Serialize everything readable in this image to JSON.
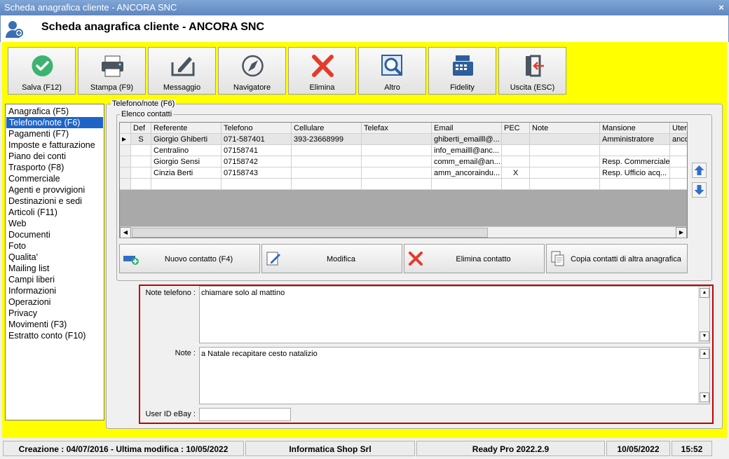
{
  "window": {
    "title": "Scheda anagrafica cliente - ANCORA SNC",
    "close": "×"
  },
  "header": {
    "title": "Scheda anagrafica cliente - ANCORA SNC"
  },
  "toolbar": [
    {
      "label": "Salva (F12)",
      "icon": "check-icon"
    },
    {
      "label": "Stampa (F9)",
      "icon": "printer-icon"
    },
    {
      "label": "Messaggio",
      "icon": "message-icon"
    },
    {
      "label": "Navigatore",
      "icon": "compass-icon"
    },
    {
      "label": "Elimina",
      "icon": "delete-icon"
    },
    {
      "label": "Altro",
      "icon": "magnifier-icon"
    },
    {
      "label": "Fidelity",
      "icon": "cash-register-icon"
    },
    {
      "label": "Uscita (ESC)",
      "icon": "exit-icon"
    }
  ],
  "sidebar": {
    "selected": 1,
    "items": [
      "Anagrafica (F5)",
      "Telefono/note (F6)",
      "Pagamenti (F7)",
      "Imposte e fatturazione",
      "Piano dei conti",
      "Trasporto (F8)",
      "Commerciale",
      "Agenti e provvigioni",
      "Destinazioni e sedi",
      "Articoli (F11)",
      "Web",
      "Documenti",
      "Foto",
      "Qualita'",
      "Mailing list",
      "Campi liberi",
      "Informazioni",
      "Operazioni",
      "Privacy",
      "Movimenti (F3)",
      "Estratto conto (F10)"
    ]
  },
  "panel": {
    "legend": "Telefono/note (F6)",
    "group_legend": "Elenco contatti"
  },
  "contacts": {
    "columns": [
      "Def",
      "Referente",
      "Telefono",
      "Cellulare",
      "Telefax",
      "Email",
      "PEC",
      "Note",
      "Mansione",
      "Uter"
    ],
    "rows": [
      [
        "S",
        "Giorgio Ghiberti",
        "071-587401",
        "393-23668999",
        "",
        "ghiberti_emailll@...",
        "",
        "",
        "Amministratore",
        "anco"
      ],
      [
        "",
        "Centralino",
        "07158741",
        "",
        "",
        "info_emailll@anc...",
        "",
        "",
        "",
        ""
      ],
      [
        "",
        "Giorgio Sensi",
        "07158742",
        "",
        "",
        "comm_email@an...",
        "",
        "",
        "Resp. Commerciale",
        ""
      ],
      [
        "",
        "Cinzia Berti",
        "07158743",
        "",
        "",
        "amm_ancoraindu...",
        "X",
        "",
        "Resp. Ufficio acq...",
        ""
      ]
    ]
  },
  "buttons": {
    "new": "Nuovo contatto (F4)",
    "edit": "Modifica",
    "delete": "Elimina contatto",
    "copy": "Copia contatti di altra anagrafica"
  },
  "notes": {
    "phone_label": "Note telefono :",
    "phone_value": "chiamare solo al mattino",
    "note_label": "Note :",
    "note_value": "a Natale recapitare cesto natalizio",
    "ebay_label": "User ID eBay :",
    "ebay_value": ""
  },
  "status": {
    "dates": "Creazione : 04/07/2016 - Ultima modifica : 10/05/2022",
    "company": "Informatica Shop Srl",
    "version": "Ready Pro 2022.2.9",
    "date": "10/05/2022",
    "time": "15:52"
  },
  "colors": {
    "accent": "#1e64c8",
    "background": "#ffff00",
    "highlight": "#c00000"
  }
}
